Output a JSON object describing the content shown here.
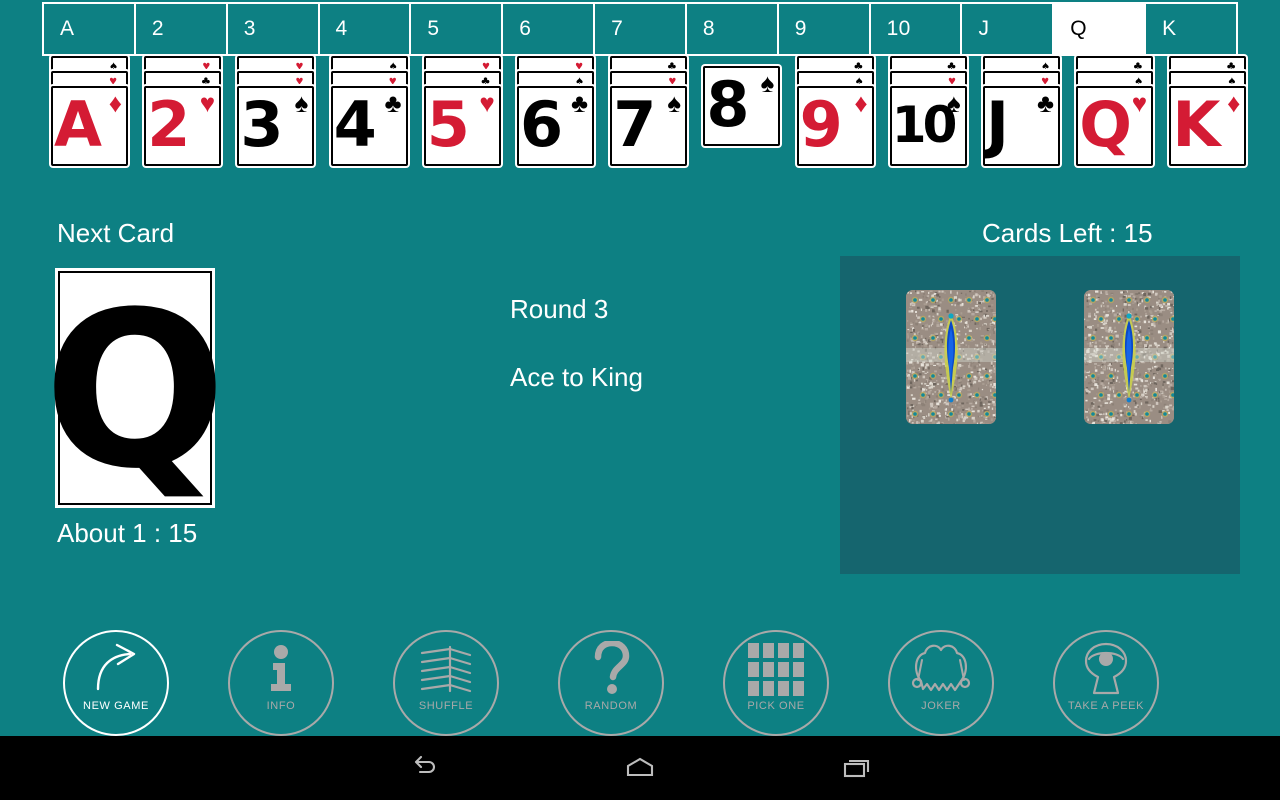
{
  "theme": {
    "background": "#0d8083",
    "panel": "#15656e",
    "card_white": "#ffffff",
    "red_suit": "#d41b34",
    "black_suit": "#000000",
    "dim_control": "#a9a9a9",
    "active_control": "#ffffff",
    "nav_bar": "#000000"
  },
  "rank_tabs": {
    "selected": "Q",
    "items": [
      {
        "label": "A",
        "active": false
      },
      {
        "label": "2",
        "active": false
      },
      {
        "label": "3",
        "active": false
      },
      {
        "label": "4",
        "active": false
      },
      {
        "label": "5",
        "active": false
      },
      {
        "label": "6",
        "active": false
      },
      {
        "label": "7",
        "active": false
      },
      {
        "label": "8",
        "active": false
      },
      {
        "label": "9",
        "active": false
      },
      {
        "label": "10",
        "active": false
      },
      {
        "label": "J",
        "active": false
      },
      {
        "label": "Q",
        "active": true
      },
      {
        "label": "K",
        "active": false
      }
    ]
  },
  "card_row": [
    {
      "rank": "A",
      "suit": "diamond",
      "suit_glyph": "♦",
      "color": "red",
      "stack": 3,
      "back_pips": [
        {
          "glyph": "♠",
          "color": "black"
        },
        {
          "glyph": "♥",
          "color": "red"
        }
      ]
    },
    {
      "rank": "2",
      "suit": "heart",
      "suit_glyph": "♥",
      "color": "red",
      "stack": 3,
      "back_pips": [
        {
          "glyph": "♥",
          "color": "red"
        },
        {
          "glyph": "♣",
          "color": "black"
        }
      ]
    },
    {
      "rank": "3",
      "suit": "spade",
      "suit_glyph": "♠",
      "color": "black",
      "stack": 3,
      "back_pips": [
        {
          "glyph": "♥",
          "color": "red"
        },
        {
          "glyph": "♥",
          "color": "red"
        }
      ]
    },
    {
      "rank": "4",
      "suit": "club",
      "suit_glyph": "♣",
      "color": "black",
      "stack": 3,
      "back_pips": [
        {
          "glyph": "♠",
          "color": "black"
        },
        {
          "glyph": "♥",
          "color": "red"
        }
      ]
    },
    {
      "rank": "5",
      "suit": "heart",
      "suit_glyph": "♥",
      "color": "red",
      "stack": 3,
      "back_pips": [
        {
          "glyph": "♥",
          "color": "red"
        },
        {
          "glyph": "♣",
          "color": "black"
        }
      ]
    },
    {
      "rank": "6",
      "suit": "club",
      "suit_glyph": "♣",
      "color": "black",
      "stack": 3,
      "back_pips": [
        {
          "glyph": "♥",
          "color": "red"
        },
        {
          "glyph": "♠",
          "color": "black"
        }
      ]
    },
    {
      "rank": "7",
      "suit": "spade",
      "suit_glyph": "♠",
      "color": "black",
      "stack": 3,
      "back_pips": [
        {
          "glyph": "♣",
          "color": "black"
        },
        {
          "glyph": "♥",
          "color": "red"
        }
      ]
    },
    {
      "rank": "8",
      "suit": "spade",
      "suit_glyph": "♠",
      "color": "black",
      "stack": 1,
      "back_pips": []
    },
    {
      "rank": "9",
      "suit": "diamond",
      "suit_glyph": "♦",
      "color": "red",
      "stack": 3,
      "back_pips": [
        {
          "glyph": "♣",
          "color": "black"
        },
        {
          "glyph": "♠",
          "color": "black"
        }
      ]
    },
    {
      "rank": "10",
      "suit": "spade",
      "suit_glyph": "♠",
      "color": "black",
      "stack": 3,
      "back_pips": [
        {
          "glyph": "♣",
          "color": "black"
        },
        {
          "glyph": "♥",
          "color": "red"
        }
      ]
    },
    {
      "rank": "J",
      "suit": "club",
      "suit_glyph": "♣",
      "color": "black",
      "stack": 3,
      "back_pips": [
        {
          "glyph": "♠",
          "color": "black"
        },
        {
          "glyph": "♥",
          "color": "red"
        }
      ]
    },
    {
      "rank": "Q",
      "suit": "heart",
      "suit_glyph": "♥",
      "color": "red",
      "stack": 3,
      "back_pips": [
        {
          "glyph": "♣",
          "color": "black"
        },
        {
          "glyph": "♠",
          "color": "black"
        }
      ]
    },
    {
      "rank": "K",
      "suit": "diamond",
      "suit_glyph": "♦",
      "color": "red",
      "stack": 3,
      "back_pips": [
        {
          "glyph": "♣",
          "color": "black"
        },
        {
          "glyph": "♠",
          "color": "black"
        }
      ]
    }
  ],
  "next_card": {
    "label": "Next Card",
    "rank": "Q",
    "odds": "About 1 :  15"
  },
  "status": {
    "round": "Round 3",
    "mode": "Ace to King"
  },
  "deck": {
    "cards_left_label": "Cards Left :  15",
    "cards_left_count": 15,
    "back_cards": 2,
    "back_art": "peacock"
  },
  "toolbar": [
    {
      "label": "NEW GAME",
      "icon": "curved-arrow-icon",
      "enabled": true
    },
    {
      "label": "INFO",
      "icon": "info-icon",
      "enabled": false
    },
    {
      "label": "SHUFFLE",
      "icon": "shuffle-cards-icon",
      "enabled": false
    },
    {
      "label": "RANDOM",
      "icon": "question-mark-icon",
      "enabled": false
    },
    {
      "label": "PICK ONE",
      "icon": "grid-icon",
      "enabled": false
    },
    {
      "label": "JOKER",
      "icon": "jester-hat-icon",
      "enabled": false
    },
    {
      "label": "TAKE A PEEK",
      "icon": "keyhole-eye-icon",
      "enabled": false
    }
  ],
  "nav_bar": {
    "back": "back-icon",
    "home": "home-icon",
    "recents": "recents-icon"
  }
}
